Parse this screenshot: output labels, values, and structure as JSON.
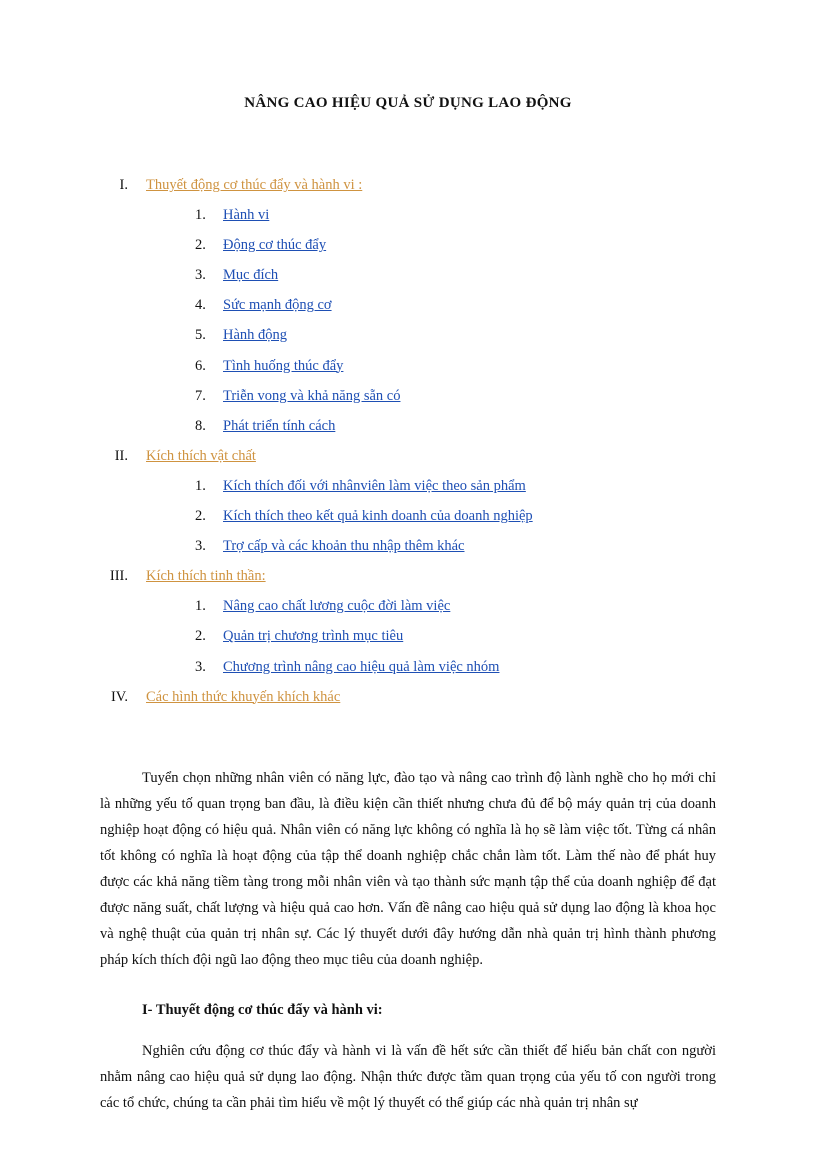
{
  "title": "NÂNG CAO HIỆU QUẢ SỬ DỤNG LAO ĐỘNG",
  "toc": [
    {
      "roman": "I.",
      "label": "Thuyết  động cơ thúc  đẩy và hành vi :",
      "items": [
        {
          "n": "1.",
          "t": "Hành vi"
        },
        {
          "n": "2.",
          "t": "Động cơ thúc đẩy"
        },
        {
          "n": "3.",
          "t": "Mục đích"
        },
        {
          "n": "4.",
          "t": "Sức mạnh  động cơ"
        },
        {
          "n": "5.",
          "t": "Hành  động "
        },
        {
          "n": "6.",
          "t": "Tình  huống thúc đẩy"
        },
        {
          "n": "7.",
          "t": "Triễn  vong  và khả năng sẵn có"
        },
        {
          "n": "8.",
          "t": "Phát triển tính cách"
        }
      ]
    },
    {
      "roman": "II.",
      "label": "Kích thích vật chất ",
      "items": [
        {
          "n": "1.",
          "t": "Kích thích đối với nhânviên làm việc theo sản phẩm "
        },
        {
          "n": "2.",
          "t": "Kích thích theo kết quả kinh doanh của doanh nghiệp "
        },
        {
          "n": "3.",
          "t": "Trợ cấp và các khoản thu nhập thêm khác"
        }
      ]
    },
    {
      "roman": "III.",
      "label": "Kích thích tinh thần: ",
      "items": [
        {
          "n": "1.",
          "t": "Nâng cao chất lương  cuộc đời làm việc"
        },
        {
          "n": "2.",
          "t": "Quản trị chương trình  mục tiêu"
        },
        {
          "n": "3.",
          "t": "Chương trình nâng cao hiệu quả làm việc nhóm "
        }
      ]
    },
    {
      "roman": "IV.",
      "label": "Các hình  thức khuyến  khích  khác ",
      "items": []
    }
  ],
  "p1": "Tuyển  chọn những nhân viên  có năng lực, đào tạo và nâng cao trình  độ lành nghề cho họ mới chỉ là những yếu tố quan trọng ban đầu, là điều kiện cần thiết nhưng chưa đủ để bộ máy quản trị của doanh nghiệp  hoạt động có hiệu quả. Nhân viên  có năng lực không có nghĩa  là họ sẽ làm việc tốt. Từng cá nhân tốt không có nghĩa  là hoạt động của tập thể doanh nghiệp  chắc chắn làm tốt. Làm thế nào để phát huy được các khả năng tiềm tàng trong mỗi nhân viên  và tạo thành sức mạnh tập thể của doanh nghiệp  để đạt được năng suất, chất lượng và hiệu quả cao hơn. Vấn đề nâng cao hiệu quả sử dụng lao động là khoa học và nghệ thuật của quản trị nhân  sự. Các lý thuyết dưới đây hướng dẫn nhà quản trị hình thành phương pháp kích thích  đội ngũ lao động theo mục tiêu của doanh nghiệp.",
  "h1": "I- Thuyết động cơ thúc đẩy và hành vi:",
  "p2": "Nghiên  cứu động cơ thúc đẩy và hành vi là vấn đề hết sức cần thiết để hiểu bản chất con người nhằm nâng cao hiệu quả sử dụng lao động. Nhận thức được tầm quan trọng của yếu tố con người trong các tổ chức, chúng ta cần phải tìm hiểu về một lý thuyết có thể giúp các nhà quản trị nhân sự"
}
